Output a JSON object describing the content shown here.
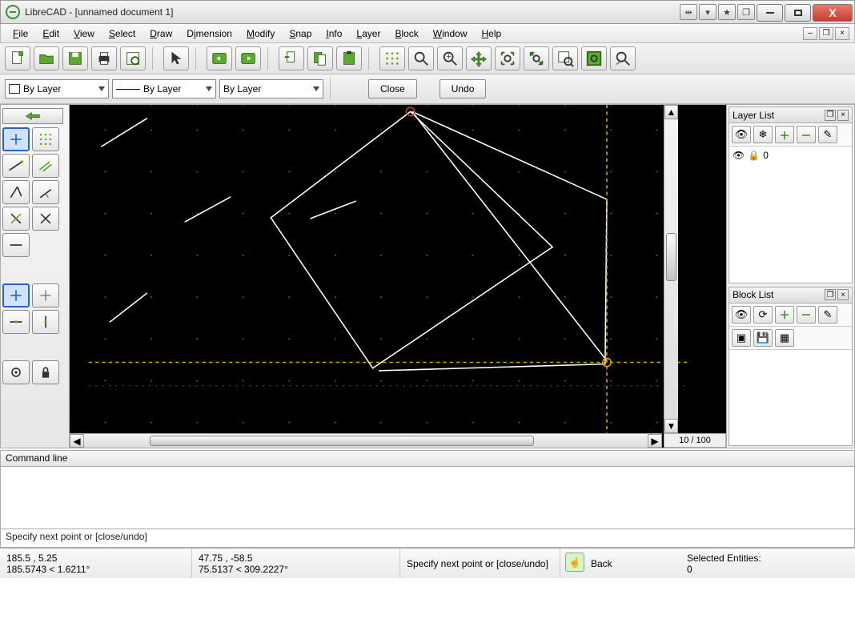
{
  "title": "LibreCAD - [unnamed document 1]",
  "menus": {
    "file": "File",
    "edit": "Edit",
    "view": "View",
    "select": "Select",
    "draw": "Draw",
    "dimension": "Dimension",
    "modify": "Modify",
    "snap": "Snap",
    "info": "Info",
    "layer": "Layer",
    "block": "Block",
    "window": "Window",
    "help": "Help"
  },
  "combos": {
    "color": "By Layer",
    "width": "By Layer",
    "linetype": "By Layer"
  },
  "buttons": {
    "close": "Close",
    "undo": "Undo",
    "back": "Back"
  },
  "panels": {
    "layer_title": "Layer List",
    "block_title": "Block List",
    "layers": [
      {
        "name": "0"
      }
    ]
  },
  "command": {
    "title": "Command line",
    "prompt": "Specify next point or [close/undo]"
  },
  "status": {
    "abs_coord": "185.5 , 5.25",
    "polar_abs": "185.5743 < 1.6211°",
    "rel_coord": "47.75 , -58.5",
    "polar_rel": "75.5137 < 309.2227°",
    "prompt": "Specify next point or [close/undo]",
    "back": "Back",
    "sel_label": "Selected Entities:",
    "sel_count": "0"
  },
  "zoom": "10 / 100"
}
